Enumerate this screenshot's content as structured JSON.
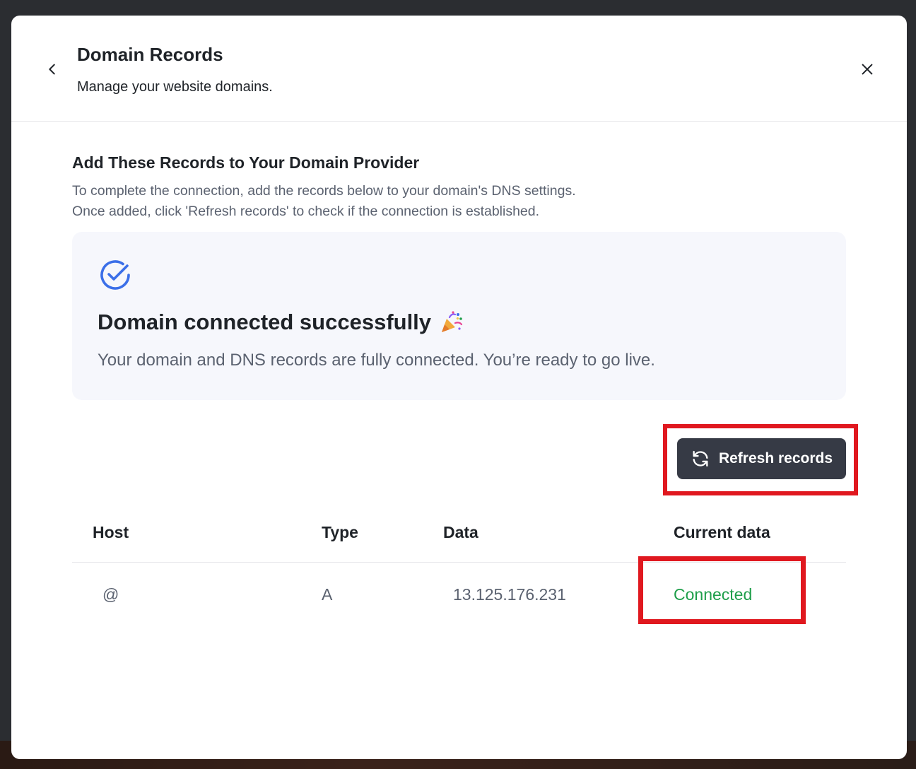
{
  "header": {
    "title": "Domain Records",
    "subtitle": "Manage your website domains."
  },
  "section": {
    "title": "Add These Records to Your Domain Provider",
    "desc_line1": "To complete the connection, add the records below to your domain's DNS settings.",
    "desc_line2": "Once added, click 'Refresh records' to check if the connection is established."
  },
  "success": {
    "title": "Domain connected successfully",
    "desc": "Your domain and DNS records are fully connected. You’re ready to go live."
  },
  "toolbar": {
    "refresh_label": "Refresh records"
  },
  "table": {
    "headers": [
      "Host",
      "Type",
      "Data",
      "Current data"
    ],
    "rows": [
      {
        "host": "@",
        "type": "A",
        "data": "13.125.176.231",
        "current": "Connected"
      }
    ]
  },
  "colors": {
    "accent_blue": "#3b6fe8",
    "success_green": "#1e9e4a",
    "button_dark": "#363a45",
    "highlight_red": "#e0181f"
  }
}
